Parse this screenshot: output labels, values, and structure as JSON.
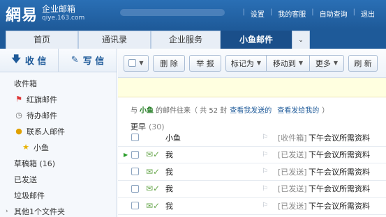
{
  "header": {
    "logo_mark": "網易",
    "logo_name": "企业邮箱",
    "logo_domain": "qiye.163.com",
    "links": [
      "设置",
      "我的客服",
      "自助查询",
      "退出"
    ]
  },
  "tabs": [
    {
      "label": "首页"
    },
    {
      "label": "通讯录"
    },
    {
      "label": "企业服务"
    },
    {
      "label": "小鱼邮件"
    }
  ],
  "sidebar": {
    "receive_label": "收 信",
    "write_label": "写 信",
    "folders": [
      {
        "label": "收件箱"
      },
      {
        "label": "红旗邮件"
      },
      {
        "label": "待办邮件"
      },
      {
        "label": "联系人邮件"
      },
      {
        "label": "小鱼"
      },
      {
        "label": "草稿箱 (16)"
      },
      {
        "label": "已发送"
      },
      {
        "label": "垃圾邮件"
      },
      {
        "label": "其他1个文件夹"
      }
    ]
  },
  "toolbar": {
    "delete_label": "删 除",
    "report_label": "举 报",
    "mark_label": "标记为",
    "move_label": "移动到",
    "more_label": "更多",
    "refresh_label": "刷 新"
  },
  "summary": {
    "prefix": "与",
    "contact": "小鱼",
    "mid": "的邮件往来（ 共 52 封",
    "link_sent_by_me": "查看我发送的",
    "link_sent_to_me": "查看发给我的",
    "suffix": "）"
  },
  "group": {
    "label": "更早",
    "count": "(30)"
  },
  "emails": [
    {
      "sender": "小鱼",
      "folder": "[收件箱]",
      "subject": "下午会议所需资料"
    },
    {
      "sender": "我",
      "folder": "[已发送]",
      "subject": "下午会议所需资料"
    },
    {
      "sender": "我",
      "folder": "[已发送]",
      "subject": "下午会议所需资料"
    },
    {
      "sender": "我",
      "folder": "[已发送]",
      "subject": "下午会议所需资料"
    },
    {
      "sender": "我",
      "folder": "[已发送]",
      "subject": "下午会议所需资料"
    }
  ],
  "colors": {
    "brand": "#1e5a99",
    "active_tab": "#1a4f8a",
    "notice_bg": "#ffffe0",
    "contact_green": "#1f7a1f"
  }
}
